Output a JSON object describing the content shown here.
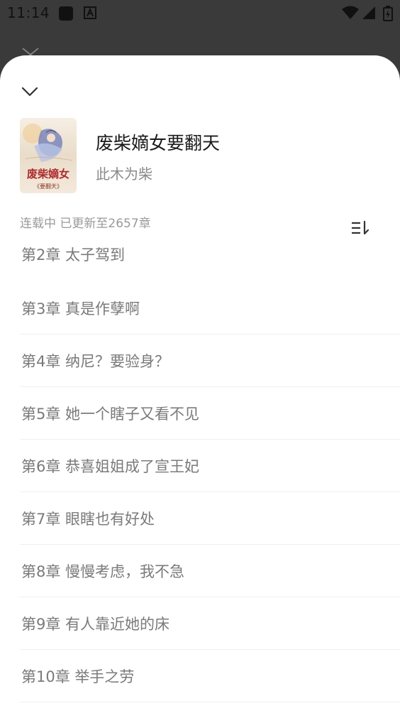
{
  "status_bar": {
    "time": "11:14"
  },
  "book": {
    "title": "废柴嫡女要翻天",
    "author": "此木为柴",
    "status": "连载中 已更新至2657章",
    "cover_text": "废柴嫡女",
    "cover_subtext": "《要翻天》"
  },
  "chapters": [
    "第2章 太子驾到",
    "第3章 真是作孽啊",
    "第4章 纳尼？要验身？",
    "第5章 她一个瞎子又看不见",
    "第6章 恭喜姐姐成了宣王妃",
    "第7章 眼瞎也有好处",
    "第8章 慢慢考虑，我不急",
    "第9章 有人靠近她的床",
    "第10章 举手之劳"
  ],
  "icons": {
    "collapse": "chevron-down-icon",
    "sort": "sort-order-icon",
    "background_close": "close-icon"
  },
  "colors": {
    "sheet": "#ffffff",
    "scrim": "#3a3a3a",
    "muted_text": "#7a7a7a"
  }
}
